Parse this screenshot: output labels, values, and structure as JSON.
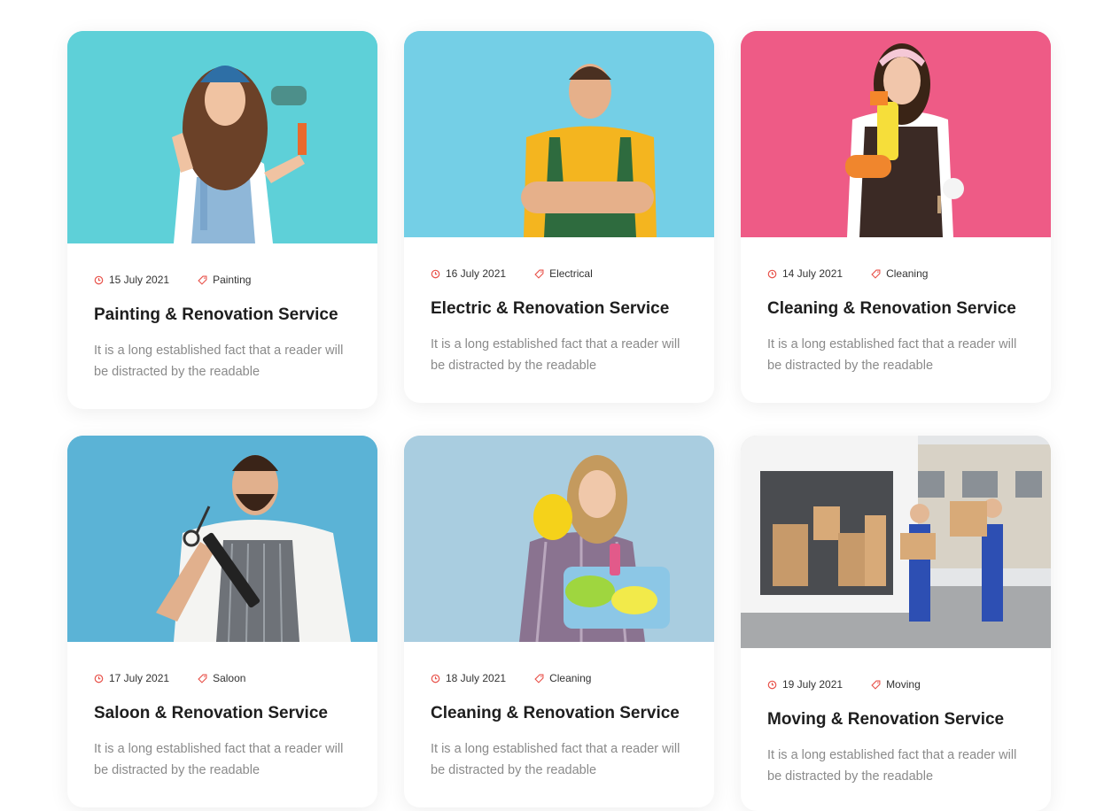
{
  "colors": {
    "accent": "#e8524a",
    "title": "#1e1e1e",
    "text_muted": "#8a8a8a",
    "card_bg": "#ffffff"
  },
  "cards": [
    {
      "image_alt": "Smiling woman in denim overalls and bandana holding a paint roller",
      "date": "15 July 2021",
      "category": "Painting",
      "title": "Painting & Renovation Service",
      "description": "It is a long established fact that a reader will be distracted by the readable",
      "bg": "#5ed0d8"
    },
    {
      "image_alt": "Smiling man in yellow t-shirt and green apron holding tools",
      "date": "16 July 2021",
      "category": "Electrical",
      "title": "Electric & Renovation Service",
      "description": "It is a long established fact that a reader will be distracted by the readable",
      "bg": "#74cfe6"
    },
    {
      "image_alt": "Smiling woman in apron with cleaning spray and brush",
      "date": "14 July 2021",
      "category": "Cleaning",
      "title": "Cleaning & Renovation Service",
      "description": "It is a long established fact that a reader will be distracted by the readable",
      "bg": "#ee5b86"
    },
    {
      "image_alt": "Bearded barber holding scissors and a comb",
      "date": "17 July 2021",
      "category": "Saloon",
      "title": "Saloon & Renovation Service",
      "description": "It is a long established fact that a reader will be distracted by the readable",
      "bg": "#5bb3d6"
    },
    {
      "image_alt": "Woman in yellow gloves holding a basket of cleaning supplies",
      "date": "18 July 2021",
      "category": "Cleaning",
      "title": "Cleaning & Renovation Service",
      "description": "It is a long established fact that a reader will be distracted by the readable",
      "bg": "#a9cde0"
    },
    {
      "image_alt": "Two movers in blue overalls carrying boxes from a white van",
      "date": "19 July 2021",
      "category": "Moving",
      "title": "Moving & Renovation Service",
      "description": "It is a long established fact that a reader will be distracted by the readable",
      "bg": "#d9d9d6"
    }
  ]
}
